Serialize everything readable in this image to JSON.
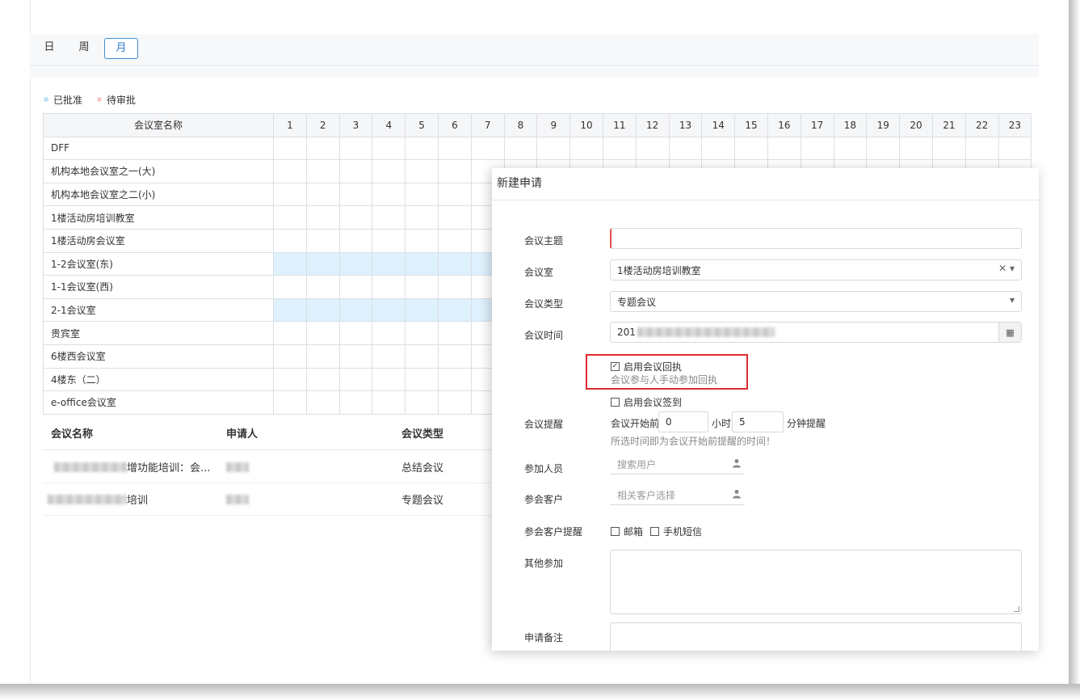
{
  "views": {
    "day": "日",
    "week": "周",
    "month": "月"
  },
  "legend": {
    "approved": {
      "label": "已批准",
      "color": "#bfe3f8"
    },
    "pending": {
      "label": "待审批",
      "color": "#f6c9c9"
    }
  },
  "grid": {
    "header_name": "会议室名称",
    "hours": [
      "1",
      "2",
      "3",
      "4",
      "5",
      "6",
      "7",
      "8",
      "9",
      "10",
      "11",
      "12",
      "13",
      "14",
      "15",
      "16",
      "17",
      "18",
      "19",
      "20",
      "21",
      "22",
      "23"
    ],
    "rooms": [
      {
        "name": "DFF",
        "highlight": false
      },
      {
        "name": "机构本地会议室之一(大)",
        "highlight": false
      },
      {
        "name": "机构本地会议室之二(小)",
        "highlight": false
      },
      {
        "name": "1楼活动房培训教室",
        "highlight": false
      },
      {
        "name": "1楼活动房会议室",
        "highlight": false
      },
      {
        "name": "1-2会议室(东)",
        "highlight": true
      },
      {
        "name": "1-1会议室(西)",
        "highlight": false
      },
      {
        "name": "2-1会议室",
        "highlight": true
      },
      {
        "name": "贵宾室",
        "highlight": false
      },
      {
        "name": "6楼西会议室",
        "highlight": false
      },
      {
        "name": "4楼东（二）",
        "highlight": false
      },
      {
        "name": "e-office会议室",
        "highlight": false
      }
    ]
  },
  "meetings": {
    "headers": {
      "name": "会议名称",
      "applicant": "申请人",
      "type": "会议类型"
    },
    "rows": [
      {
        "name_suffix": "增功能培训：会...",
        "type": "总结会议"
      },
      {
        "name_suffix": "培训",
        "type": "专题会议"
      }
    ]
  },
  "modal": {
    "title": "新建申请",
    "labels": {
      "subject": "会议主题",
      "room": "会议室",
      "type": "会议类型",
      "time": "会议时间",
      "reminder": "会议提醒",
      "attendees": "参加人员",
      "clients": "参会客户",
      "client_reminder": "参会客户提醒",
      "others": "其他参加",
      "note": "申请备注"
    },
    "subject_value": "",
    "room_value": "1楼活动房培训教室",
    "type_value": "专题会议",
    "time_prefix": "201",
    "receipt": {
      "label": "启用会议回执",
      "hint": "会议参与人手动参加回执",
      "checked": true
    },
    "signin": {
      "label": "启用会议签到",
      "checked": false
    },
    "reminder": {
      "before_label": "会议开始前",
      "hours_value": "0",
      "hours_label": "小时",
      "minutes_value": "5",
      "minutes_label": "分钟提醒",
      "hint": "所选时间即为会议开始前提醒的时间！"
    },
    "attendees_placeholder": "搜索用户",
    "clients_placeholder": "相关客户选择",
    "client_reminder_opts": {
      "email": "邮箱",
      "sms": "手机短信"
    }
  }
}
